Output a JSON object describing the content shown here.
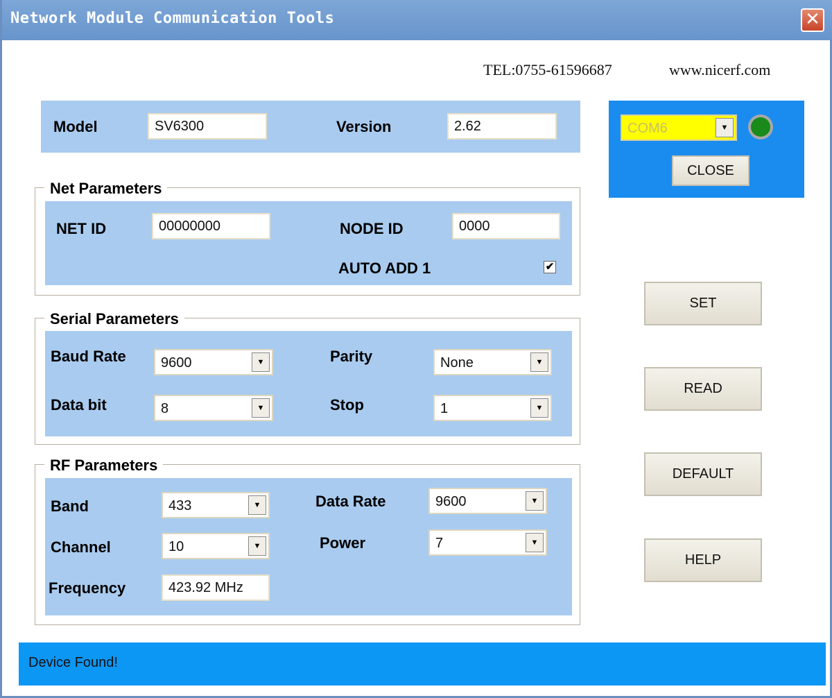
{
  "window": {
    "title": "Network Module Communication Tools",
    "close_glyph": "✕"
  },
  "contact": {
    "tel": "TEL:0755-61596687",
    "website": "www.nicerf.com"
  },
  "info": {
    "model_label": "Model",
    "model_value": "SV6300",
    "version_label": "Version",
    "version_value": "2.62"
  },
  "port": {
    "selected": "COM6",
    "close_label": "CLOSE",
    "indicator_color": "#1a8a1a"
  },
  "net": {
    "title": "Net Parameters",
    "net_id_label": "NET  ID",
    "net_id_value": "00000000",
    "node_id_label": "NODE  ID",
    "node_id_value": "0000",
    "auto_add_label": "AUTO ADD 1",
    "auto_add_checked": "✔"
  },
  "serial": {
    "title": "Serial Parameters",
    "baud_label": "Baud Rate",
    "baud_value": "9600",
    "parity_label": "Parity",
    "parity_value": "None",
    "databit_label": "Data bit",
    "databit_value": "8",
    "stop_label": "Stop",
    "stop_value": "1"
  },
  "rf": {
    "title": "RF Parameters",
    "band_label": "Band",
    "band_value": "433",
    "datarate_label": "Data Rate",
    "datarate_value": "9600",
    "channel_label": "Channel",
    "channel_value": "10",
    "power_label": "Power",
    "power_value": "7",
    "frequency_label": "Frequency",
    "frequency_value": "423.92 MHz"
  },
  "actions": {
    "set": "SET",
    "read": "READ",
    "default": "DEFAULT",
    "help": "HELP"
  },
  "status": {
    "message": "Device Found!"
  },
  "colors": {
    "panel": "#a9cbef",
    "port_panel": "#1a8cf0",
    "status_bar": "#0c97f5",
    "port_combo": "#ffff00"
  }
}
